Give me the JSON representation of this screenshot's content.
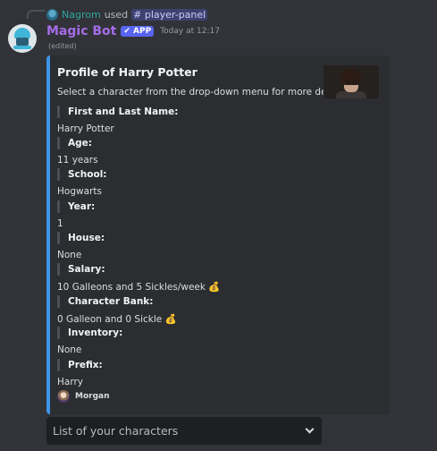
{
  "command": {
    "user": "Nagrom",
    "used_text": "used",
    "command_name": "# player-panel"
  },
  "message": {
    "bot_name": "Magic Bot",
    "app_badge": "✔ APP",
    "timestamp": "Today at 12:17",
    "edited": "(edited)"
  },
  "embed": {
    "accent_color": "#3d95e6",
    "title": "Profile of Harry Potter",
    "description": "Select a character from the drop-down menu for more details.",
    "fields": [
      {
        "name": "First and Last Name:",
        "value": "Harry Potter"
      },
      {
        "name": "Age:",
        "value": "11 years"
      },
      {
        "name": "School:",
        "value": "Hogwarts"
      },
      {
        "name": "Year:",
        "value": "1"
      },
      {
        "name": "House:",
        "value": "None"
      },
      {
        "name": "Salary:",
        "value": "10 Galleons and 5 Sickles/week 💰"
      },
      {
        "name": "Character Bank:",
        "value": "0 Galleon and 0 Sickle 💰"
      },
      {
        "name": "Inventory:",
        "value": "None"
      },
      {
        "name": "Prefix:",
        "value": "Harry"
      }
    ],
    "footer": "Morgan"
  },
  "select_menu": {
    "placeholder": "List of your characters"
  }
}
